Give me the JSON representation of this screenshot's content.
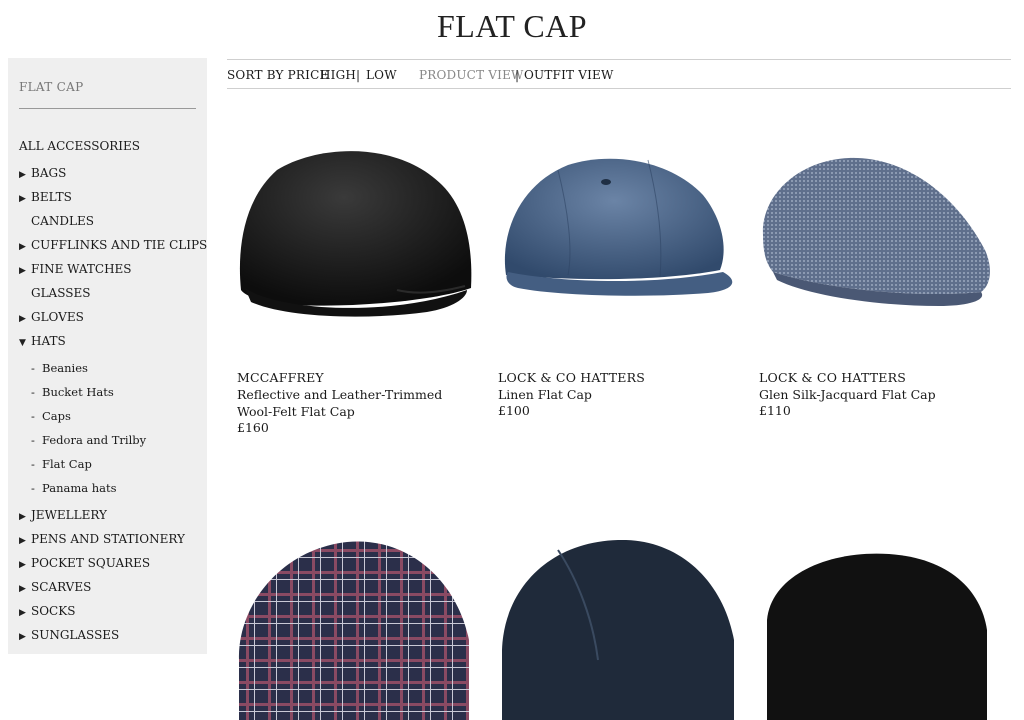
{
  "page": {
    "title": "FLAT CAP"
  },
  "sidebar": {
    "heading": "FLAT CAP",
    "items": [
      {
        "label": "ALL ACCESSORIES",
        "arrow": "",
        "sub": false
      },
      {
        "label": "BAGS",
        "arrow": "right",
        "sub": false
      },
      {
        "label": "BELTS",
        "arrow": "right",
        "sub": false
      },
      {
        "label": "CANDLES",
        "arrow": "",
        "sub": false
      },
      {
        "label": "CUFFLINKS AND TIE CLIPS",
        "arrow": "right",
        "sub": false
      },
      {
        "label": "FINE WATCHES",
        "arrow": "right",
        "sub": false
      },
      {
        "label": "GLASSES",
        "arrow": "",
        "sub": false
      },
      {
        "label": "GLOVES",
        "arrow": "right",
        "sub": false
      },
      {
        "label": "HATS",
        "arrow": "down",
        "sub": false
      },
      {
        "label": "Beanies",
        "arrow": "",
        "sub": true
      },
      {
        "label": "Bucket Hats",
        "arrow": "",
        "sub": true
      },
      {
        "label": "Caps",
        "arrow": "",
        "sub": true
      },
      {
        "label": "Fedora and Trilby",
        "arrow": "",
        "sub": true
      },
      {
        "label": "Flat Cap",
        "arrow": "",
        "sub": true
      },
      {
        "label": "Panama hats",
        "arrow": "",
        "sub": true
      },
      {
        "label": "JEWELLERY",
        "arrow": "right",
        "sub": false
      },
      {
        "label": "PENS AND STATIONERY",
        "arrow": "right",
        "sub": false
      },
      {
        "label": "POCKET SQUARES",
        "arrow": "right",
        "sub": false
      },
      {
        "label": "SCARVES",
        "arrow": "right",
        "sub": false
      },
      {
        "label": "SOCKS",
        "arrow": "right",
        "sub": false
      },
      {
        "label": "SUNGLASSES",
        "arrow": "right",
        "sub": false
      }
    ]
  },
  "toolbar": {
    "sort_label": "SORT BY PRICE",
    "high": "HIGH",
    "separator": "|",
    "low": "LOW",
    "product_view": "PRODUCT VIEW",
    "outfit_view": "OUTFIT VIEW"
  },
  "products": [
    {
      "brand": "MCCAFFREY",
      "name": "Reflective and Leather-Trimmed Wool-Felt Flat Cap",
      "price": "£160",
      "image": "black-wool-flat-cap"
    },
    {
      "brand": "LOCK & CO HATTERS",
      "name": "Linen Flat Cap",
      "price": "£100",
      "image": "blue-linen-newsboy-cap"
    },
    {
      "brand": "LOCK & CO HATTERS",
      "name": "Glen Silk-Jacquard Flat Cap",
      "price": "£110",
      "image": "blue-jacquard-flat-cap"
    },
    {
      "brand": "",
      "name": "",
      "price": "",
      "image": "plaid-flat-cap"
    },
    {
      "brand": "",
      "name": "",
      "price": "",
      "image": "navy-flat-cap"
    },
    {
      "brand": "",
      "name": "",
      "price": "",
      "image": "black-flat-cap"
    }
  ],
  "colors": {
    "sidebar_bg": "#efefef",
    "muted": "#888888",
    "text": "#1a1a1a"
  }
}
